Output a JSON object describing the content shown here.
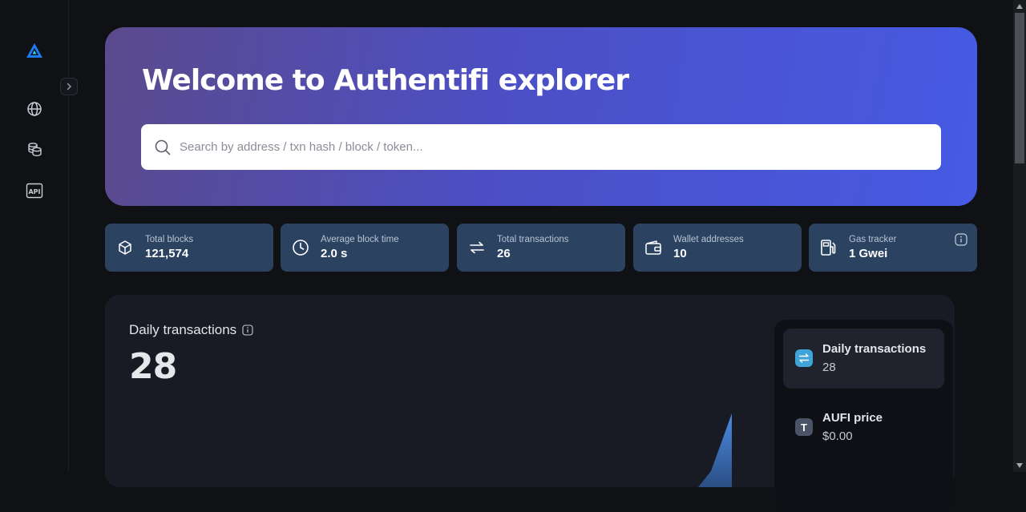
{
  "app": {
    "accent": "#4a5ce3",
    "icons": [
      "authentifi-logo-icon",
      "chevron-right-icon",
      "globe-icon",
      "coins-icon",
      "api-icon",
      "search-icon",
      "info-icon"
    ]
  },
  "hero": {
    "title": "Welcome to Authentifi explorer",
    "search_placeholder": "Search by address / txn hash / block / token..."
  },
  "sidebar": {
    "api_label": "API"
  },
  "stats": [
    {
      "label": "Total blocks",
      "value": "121,574",
      "icon": "cube-icon"
    },
    {
      "label": "Average block time",
      "value": "2.0 s",
      "icon": "clock-icon"
    },
    {
      "label": "Total transactions",
      "value": "26",
      "icon": "transfer-arrows-icon"
    },
    {
      "label": "Wallet addresses",
      "value": "10",
      "icon": "wallet-icon"
    },
    {
      "label": "Gas tracker",
      "value": "1 Gwei",
      "icon": "gas-pump-icon"
    }
  ],
  "panel": {
    "title": "Daily transactions",
    "value": "28",
    "side_cards": [
      {
        "title": "Daily transactions",
        "value": "28",
        "icon": "transfer-arrows-icon"
      },
      {
        "title": "AUFI price",
        "value": "$0.00",
        "icon_letter": "T"
      }
    ]
  }
}
